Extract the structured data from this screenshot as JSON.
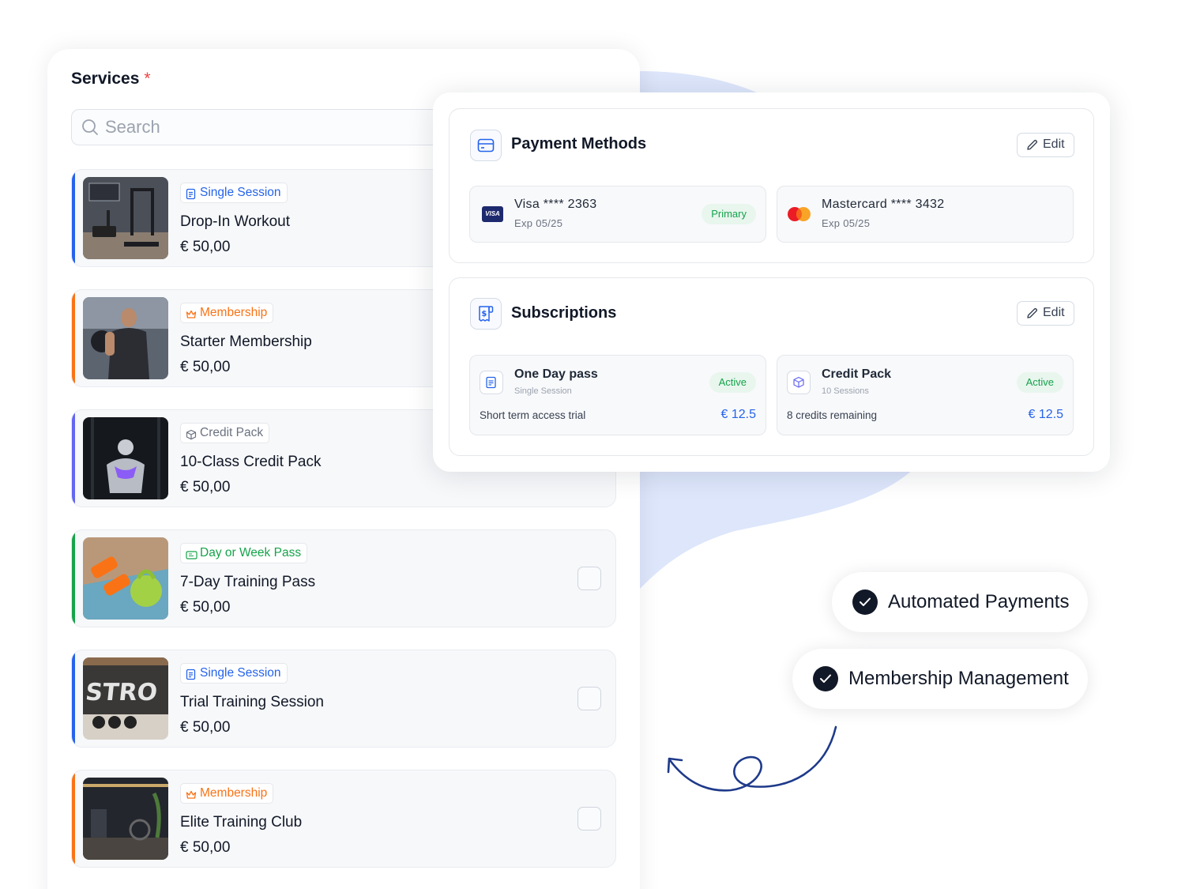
{
  "colors": {
    "blob": "#dfe7fb",
    "accent_single_session": "#2563eb",
    "accent_membership": "#f97316",
    "accent_credit_pack": "#6366f1",
    "accent_day_pass": "#16a34a",
    "price_blue": "#2563eb",
    "active_green": "#16a34a",
    "required_red": "#ef4444"
  },
  "services": {
    "title": "Services",
    "required_mark": "*",
    "search": {
      "placeholder": "Search",
      "icon": "search-icon"
    },
    "items": [
      {
        "tag": "Single Session",
        "tag_icon": "clipboard-icon",
        "tag_color": "#2563eb",
        "name": "Drop-In Workout",
        "price": "€ 50,00",
        "image": "gym-equipment-photo"
      },
      {
        "tag": "Membership",
        "tag_icon": "crown-icon",
        "tag_color": "#f97316",
        "name": "Starter Membership",
        "price": "€ 50,00",
        "image": "athlete-lifting-photo"
      },
      {
        "tag": "Credit Pack",
        "tag_icon": "box-icon",
        "tag_color": "#6b7280",
        "name": "10-Class Credit Pack",
        "price": "€ 50,00",
        "image": "athlete-back-photo"
      },
      {
        "tag": "Day or Week Pass",
        "tag_icon": "ticket-icon",
        "tag_color": "#16a34a",
        "name": "7-Day Training Pass",
        "price": "€ 50,00",
        "image": "dumbbells-photo"
      },
      {
        "tag": "Single Session",
        "tag_icon": "clipboard-icon",
        "tag_color": "#2563eb",
        "name": "Trial Training Session",
        "price": "€ 50,00",
        "image": "stay-strong-wall-photo"
      },
      {
        "tag": "Membership",
        "tag_icon": "crown-icon",
        "tag_color": "#f97316",
        "name": "Elite Training Club",
        "price": "€ 50,00",
        "image": "dark-gym-photo"
      }
    ]
  },
  "payment_methods": {
    "title": "Payment Methods",
    "edit_label": "Edit",
    "cards": [
      {
        "brand": "Visa",
        "brand_mark": "VISA",
        "label": "Visa **** 2363",
        "expiry": "Exp 05/25",
        "badge": "Primary"
      },
      {
        "brand": "Mastercard",
        "label": "Mastercard **** 3432",
        "expiry": "Exp 05/25"
      }
    ]
  },
  "subscriptions": {
    "title": "Subscriptions",
    "edit_label": "Edit",
    "items": [
      {
        "name": "One Day pass",
        "type": "Single Session",
        "status": "Active",
        "description": "Short term access trial",
        "price": "€ 12.5"
      },
      {
        "name": "Credit Pack",
        "type": "10 Sessions",
        "status": "Active",
        "description": "8 credits remaining",
        "price": "€ 12.5"
      }
    ]
  },
  "features": [
    "Automated Payments",
    "Membership Management"
  ]
}
